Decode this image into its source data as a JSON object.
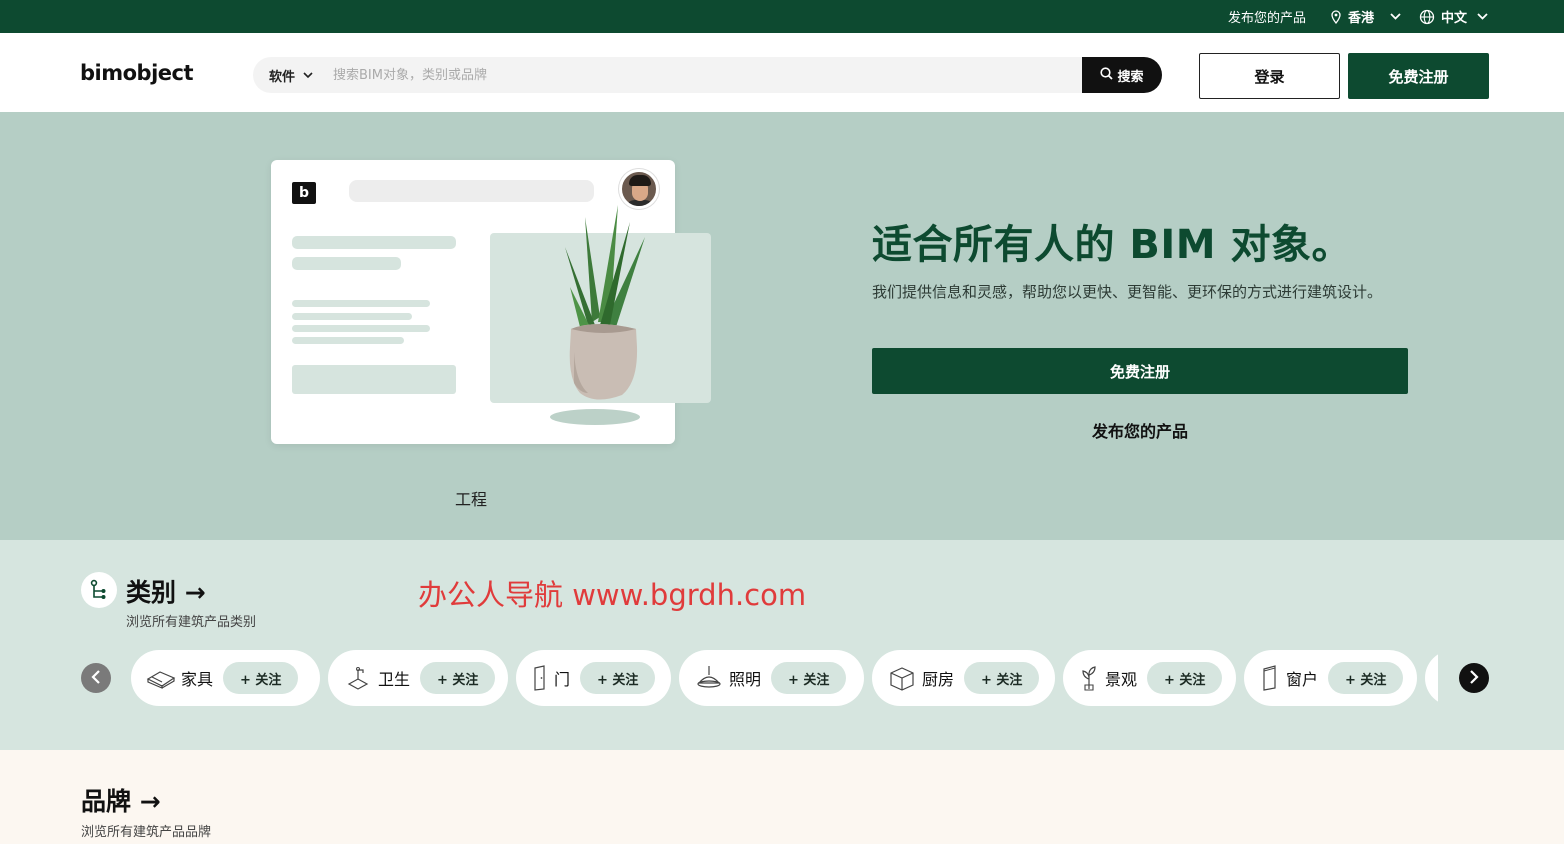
{
  "topbar": {
    "publish": "发布您的产品",
    "region": "香港",
    "language": "中文"
  },
  "header": {
    "logo": "bimobject",
    "search_scope": "软件",
    "search_placeholder": "搜索BIM对象，类别或品牌",
    "search_button": "搜索",
    "login": "登录",
    "register": "免费注册"
  },
  "hero": {
    "card_label": "工程",
    "title": "适合所有人的 BIM 对象。",
    "description": "我们提供信息和灵感，帮助您以更快、更智能、更环保的方式进行建筑设计。",
    "cta": "免费注册",
    "link": "发布您的产品"
  },
  "categories": {
    "title": "类别 →",
    "subtitle": "浏览所有建筑产品类别",
    "watermark": "办公人导航  www.bgrdh.com",
    "follow_label": "+ 关注",
    "items": [
      {
        "label": "家具",
        "icon": "sofa-icon"
      },
      {
        "label": "卫生",
        "icon": "faucet-icon"
      },
      {
        "label": "门",
        "icon": "door-icon"
      },
      {
        "label": "照明",
        "icon": "lamp-icon"
      },
      {
        "label": "厨房",
        "icon": "cabinet-icon"
      },
      {
        "label": "景观",
        "icon": "plant-icon"
      },
      {
        "label": "窗户",
        "icon": "window-icon"
      }
    ]
  },
  "brands": {
    "title": "品牌 →",
    "subtitle": "浏览所有建筑产品品牌"
  },
  "colors": {
    "brand_green": "#0d4a30",
    "hero_bg": "#b5cec5",
    "category_bg": "#d6e5df",
    "brands_bg": "#fcf7f1",
    "watermark": "#e03b3b"
  }
}
